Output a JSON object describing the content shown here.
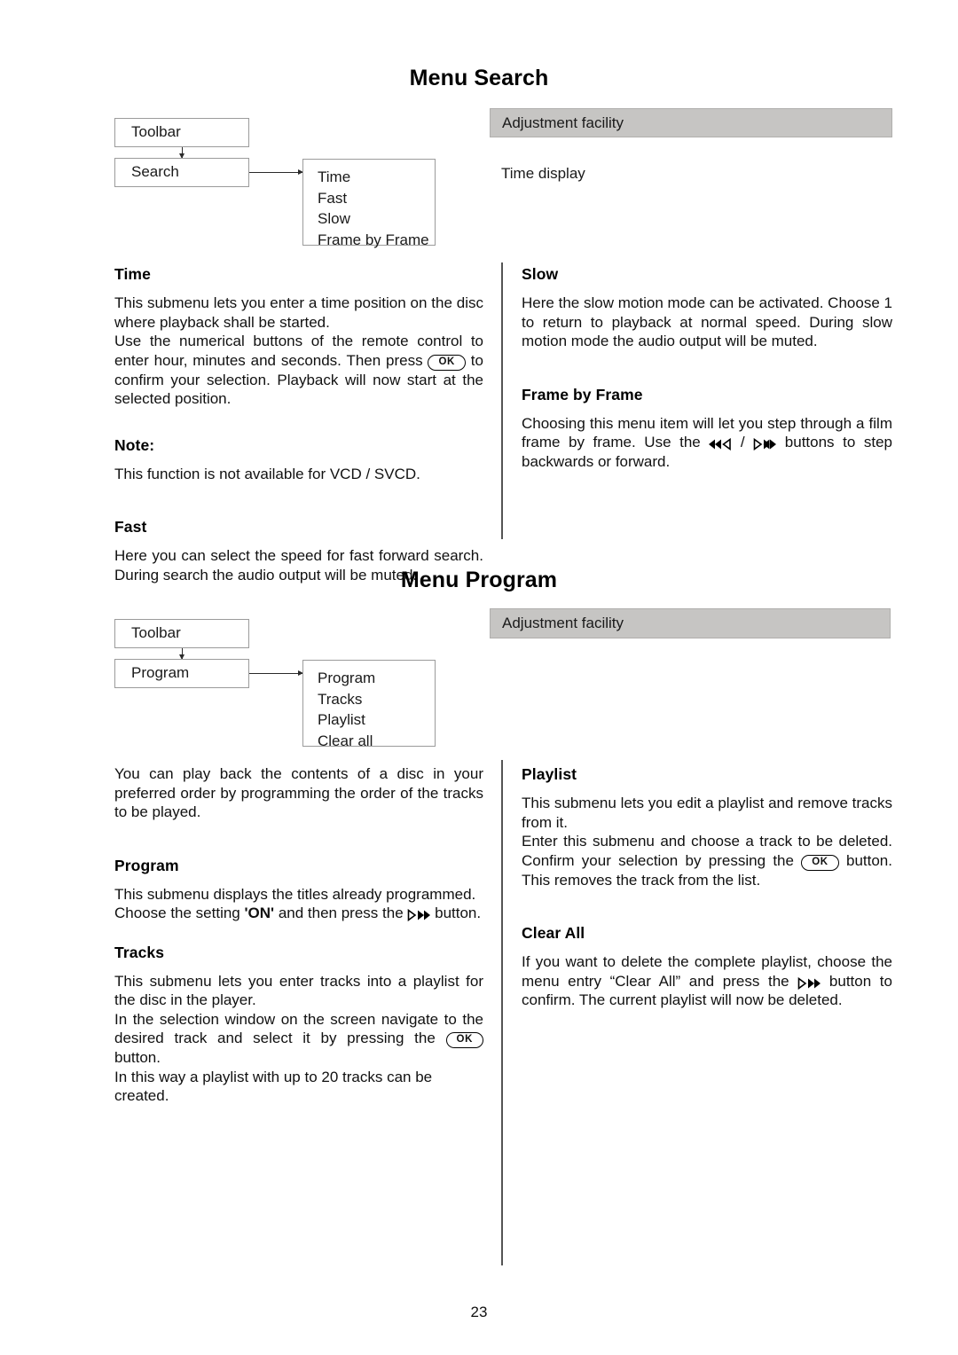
{
  "page": {
    "number": "23"
  },
  "sections": [
    {
      "title": "Menu Search",
      "diagram": {
        "toolbar_label": "Toolbar",
        "menu_label": "Search",
        "submenu_items": [
          "Time",
          "Fast",
          "Slow",
          "Frame by Frame"
        ]
      },
      "adjustment_bar": "Adjustment facility",
      "adjustment_note": "Time display",
      "left_column": [
        {
          "heading": "Time",
          "paragraphs": [
            "This submenu lets you enter a time position on the disc where playback shall be started.",
            "Use the numerical buttons of the remote control to enter hour, minutes and seconds. Then press  [OK]  to confirm your selection. Playback will now start at the selected position."
          ]
        },
        {
          "heading": "Note:",
          "paragraphs": [
            "This function is not available for VCD / SVCD."
          ]
        },
        {
          "heading": "Fast",
          "paragraphs": [
            "Here you can select the speed for fast forward search. During search the audio output will be muted."
          ]
        }
      ],
      "right_column": [
        {
          "heading": "Slow",
          "paragraphs": [
            "Here the slow motion mode can be activated. Choose 1 to return to playback at normal speed. During slow motion mode the audio output will be muted."
          ]
        },
        {
          "heading": "Frame by Frame",
          "paragraphs": [
            "Choosing this menu item will let you step through a film frame by frame. Use the  [REV] / [FWD]  buttons to step backwards or forward."
          ]
        }
      ]
    },
    {
      "title": "Menu Program",
      "diagram": {
        "toolbar_label": "Toolbar",
        "menu_label": "Program",
        "submenu_items": [
          "Program",
          "Tracks",
          "Playlist",
          "Clear all"
        ]
      },
      "adjustment_bar": "Adjustment facility",
      "left_column": [
        {
          "heading": "",
          "paragraphs": [
            "You can play back the contents of a disc in your preferred order by programming the order of the tracks to be played."
          ]
        },
        {
          "heading": "Program",
          "paragraphs": [
            "This submenu displays the titles already programmed.",
            "Choose the setting 'ON' and then press the  [FWD]  button."
          ]
        },
        {
          "heading": "Tracks",
          "paragraphs": [
            "This submenu lets you enter tracks into a playlist for the disc in the player.",
            "In the selection window on the screen navigate to the desired track and select it by pressing the  [OK]  button.",
            "In this way a playlist with up to 20 tracks can be created."
          ]
        }
      ],
      "right_column": [
        {
          "heading": "Playlist",
          "paragraphs": [
            "This submenu lets you edit a playlist and remove tracks from it.",
            "Enter this submenu and choose a track to be deleted. Confirm your selection by pressing the  [OK]  button. This removes the track from the list."
          ]
        },
        {
          "heading": "Clear All",
          "paragraphs": [
            "If you want to delete the complete playlist, choose the menu entry “Clear All” and press the  [FWD]  button to confirm. The current playlist will now be deleted."
          ]
        }
      ]
    }
  ],
  "text": {
    "s1_time_p1": "This submenu lets you enter a time position on the disc where playback shall be started.",
    "s1_time_p2a": "Use the numerical buttons of the remote control to enter hour, minutes and seconds. Then press",
    "s1_time_p2b": "to confirm your selection. Playback will now start at the selected position.",
    "s1_note_p1": "This function is not available for VCD / SVCD.",
    "s1_fast_p1": "Here you can select the speed for fast forward search. During search the audio output will be muted.",
    "s1_slow_p1": "Here the slow motion mode can be activated. Choose 1 to return to playback at normal speed. During slow motion mode the audio output will be muted.",
    "s1_fbf_p1a": "Choosing this menu item will let you step through a film frame by frame. Use the",
    "s1_fbf_sep": "/",
    "s1_fbf_p1b": "buttons to step backwards or forward.",
    "s2_intro_p1": "You can play back the contents of a disc in your preferred order by programming the order of the tracks to be played.",
    "s2_program_p1": "This submenu displays the titles already programmed.",
    "s2_program_p2a": "Choose the setting",
    "s2_program_on": "'ON'",
    "s2_program_p2b": "and then press the",
    "s2_program_p2c": "button.",
    "s2_tracks_p1": "This submenu lets you enter tracks into a playlist for the disc in the player.",
    "s2_tracks_p2a": "In the selection window on the screen navigate to the desired track and select it by pressing the",
    "s2_tracks_p2b": "button.",
    "s2_tracks_p3": "In this way a playlist with up to 20 tracks can be created.",
    "s2_playlist_p1": "This submenu lets you edit a playlist and remove tracks from it.",
    "s2_playlist_p2a": "Enter this submenu and choose a track to be deleted. Confirm your selection by pressing the",
    "s2_playlist_p2b": "button. This removes the track from the list.",
    "s2_clearall_p1a": "If you want to delete the complete playlist, choose the menu entry “Clear All” and press the",
    "s2_clearall_p1b": "button to confirm. The current playlist will now be deleted."
  },
  "glyphs": {
    "ok_label": "OK",
    "rev_name": "rewind-step-back-icon",
    "fwd_name": "forward-step-icon"
  },
  "colors": {
    "grey_bar": "#c6c5c3",
    "box_border": "#9b9b9b",
    "divider": "#555555",
    "text": "#111111"
  }
}
